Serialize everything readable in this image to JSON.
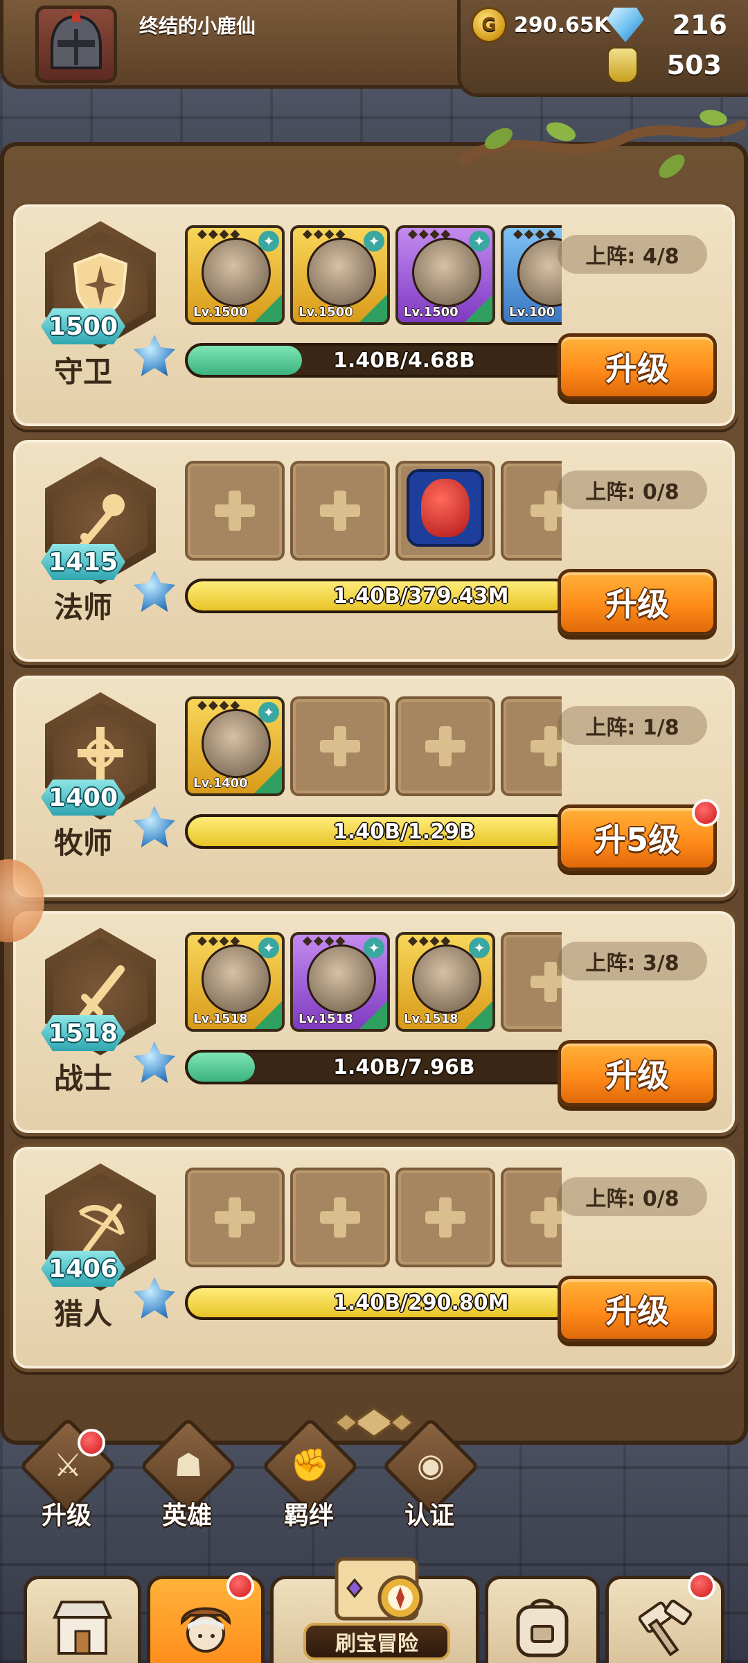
{
  "player": {
    "name": "终结的小鹿仙",
    "avatar_icon": "knight-helmet-avatar"
  },
  "currency": {
    "gold": "290.65K",
    "gems": "216",
    "potions": "503"
  },
  "classes": [
    {
      "name": "守卫",
      "level": "1500",
      "icon": "shield-icon",
      "deployed": "上阵: 4/8",
      "progress_text": "1.40B/4.68B",
      "progress_fraction": 0.299,
      "progress_color": "green",
      "upgrade_label": "升级",
      "red_dot": false,
      "slots": [
        {
          "type": "hero",
          "rarity": "gold",
          "level": "Lv.1500"
        },
        {
          "type": "hero",
          "rarity": "gold",
          "level": "Lv.1500"
        },
        {
          "type": "hero",
          "rarity": "purple",
          "level": "Lv.1500"
        },
        {
          "type": "hero",
          "rarity": "blue",
          "level": "Lv.100"
        }
      ]
    },
    {
      "name": "法师",
      "level": "1415",
      "icon": "magic-staff-icon",
      "deployed": "上阵: 0/8",
      "progress_text": "1.40B/379.43M",
      "progress_fraction": 1.0,
      "progress_color": "yellow",
      "upgrade_label": "升级",
      "red_dot": false,
      "slots": [
        {
          "type": "empty"
        },
        {
          "type": "empty"
        },
        {
          "type": "monster"
        },
        {
          "type": "empty"
        }
      ]
    },
    {
      "name": "牧师",
      "level": "1400",
      "icon": "holy-cross-icon",
      "deployed": "上阵: 1/8",
      "progress_text": "1.40B/1.29B",
      "progress_fraction": 1.0,
      "progress_color": "yellow",
      "upgrade_label": "升5级",
      "red_dot": true,
      "slots": [
        {
          "type": "hero",
          "rarity": "gold",
          "level": "Lv.1400"
        },
        {
          "type": "empty"
        },
        {
          "type": "empty"
        },
        {
          "type": "empty"
        }
      ]
    },
    {
      "name": "战士",
      "level": "1518",
      "icon": "sword-icon",
      "deployed": "上阵: 3/8",
      "progress_text": "1.40B/7.96B",
      "progress_fraction": 0.176,
      "progress_color": "green",
      "upgrade_label": "升级",
      "red_dot": false,
      "slots": [
        {
          "type": "hero",
          "rarity": "gold",
          "level": "Lv.1518"
        },
        {
          "type": "hero",
          "rarity": "purple",
          "level": "Lv.1518"
        },
        {
          "type": "hero",
          "rarity": "gold",
          "level": "Lv.1518"
        },
        {
          "type": "empty"
        }
      ]
    },
    {
      "name": "猎人",
      "level": "1406",
      "icon": "crossbow-icon",
      "deployed": "上阵: 0/8",
      "progress_text": "1.40B/290.80M",
      "progress_fraction": 1.0,
      "progress_color": "yellow",
      "upgrade_label": "升级",
      "red_dot": false,
      "slots": [
        {
          "type": "empty"
        },
        {
          "type": "empty"
        },
        {
          "type": "empty"
        },
        {
          "type": "empty"
        }
      ]
    }
  ],
  "functions": [
    {
      "label": "升级",
      "icon": "upgrade-sword-icon",
      "red_dot": true
    },
    {
      "label": "英雄",
      "icon": "hero-bust-icon",
      "red_dot": false
    },
    {
      "label": "羁绊",
      "icon": "handshake-icon",
      "red_dot": false
    },
    {
      "label": "认证",
      "icon": "eye-icon",
      "red_dot": false
    }
  ],
  "nav": {
    "tabs": [
      {
        "icon": "shop-icon",
        "active": false,
        "red_dot": false
      },
      {
        "icon": "hero-portrait-icon",
        "active": true,
        "red_dot": true
      },
      {
        "icon": "treasure-map-icon",
        "label": "刷宝冒险",
        "active": false,
        "red_dot": false
      },
      {
        "icon": "backpack-icon",
        "active": false,
        "red_dot": false
      },
      {
        "icon": "forge-hammer-icon",
        "active": false,
        "red_dot": true
      }
    ]
  },
  "colors": {
    "accent_orange": "#ff8c1a",
    "progress_green": "#3bb27f",
    "progress_yellow": "#e8c427",
    "badge_teal": "#2fa6b0",
    "wood_dark": "#3a2613"
  }
}
